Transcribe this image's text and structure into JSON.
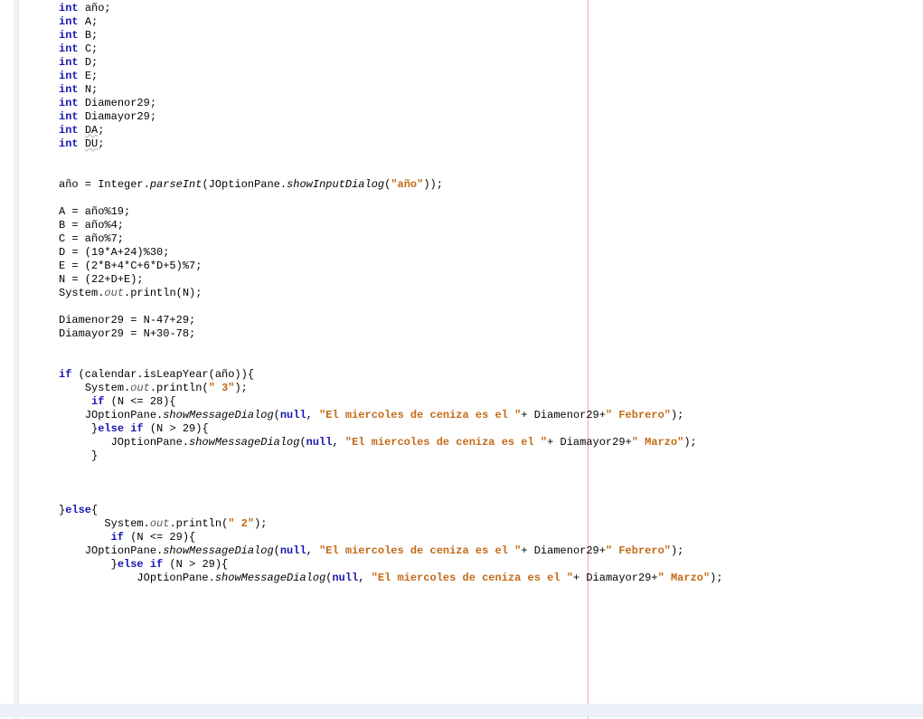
{
  "tokens": {
    "kw_int": "int",
    "kw_if": "if",
    "kw_else": "else",
    "kw_null": "null",
    "kw_else_if": "else if",
    "var_ano": "año",
    "var_A": "A",
    "var_B": "B",
    "var_C": "C",
    "var_D": "D",
    "var_E": "E",
    "var_N": "N",
    "var_Diamenor29": "Diamenor29",
    "var_Diamayor29": "Diamayor29",
    "var_DA": "DA",
    "var_DU": "DU",
    "cls_Integer": "Integer",
    "m_parseInt": "parseInt",
    "cls_JOptionPane": "JOptionPane",
    "m_showInputDialog": "showInputDialog",
    "m_showMessageDialog": "showMessageDialog",
    "str_ano": "\"año\"",
    "str_3": "\" 3\"",
    "str_2": "\" 2\"",
    "str_ceniza": "\"El miercoles de ceniza es el \"",
    "str_feb": "\" Febrero\"",
    "str_mar": "\" Marzo\"",
    "cls_System": "System",
    "f_out": "out",
    "m_println": "println",
    "expr_ano19": "A = año%19;",
    "expr_ano4": "B = año%4;",
    "expr_ano7": "C = año%7;",
    "expr_D": "D = (19*A+24)%30;",
    "expr_E": "E = (2*B+4*C+6*D+5)%7;",
    "expr_N": "N = (22+D+E);",
    "expr_menor": "Diamenor29 = N-47+29;",
    "expr_mayor": "Diamayor29 = N+30-78;",
    "call_isLeap": " (calendar.isLeapYear(año)){",
    "cond_28": " (N <= 28){",
    "cond_29a": " (N > 29){",
    "cond_29b": " (N <= 29){",
    "cond_29c": " (N > 29){",
    "plus_menor": "+ Diamenor29+",
    "plus_mayor": "+ Diamayor29+"
  }
}
